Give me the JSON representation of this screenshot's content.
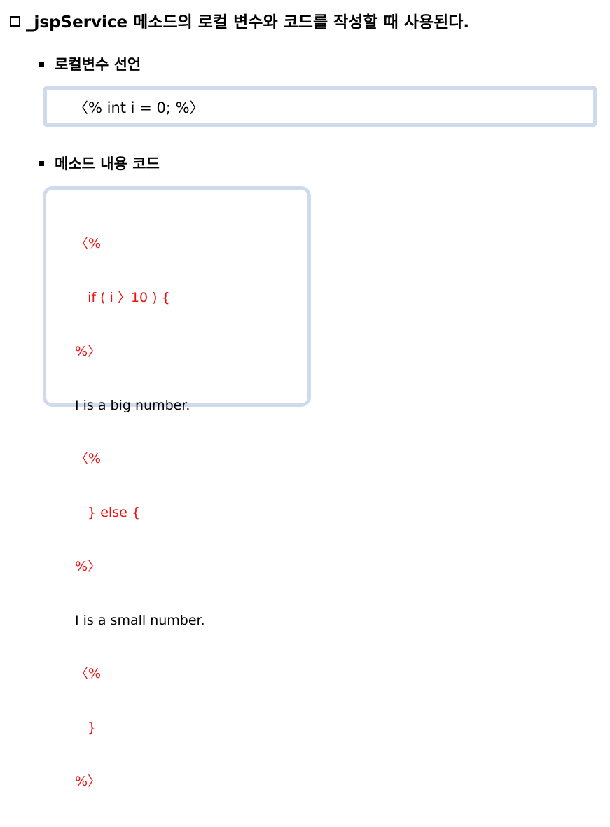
{
  "heading": {
    "text": "_jspService 메소드의 로컬 변수와 코드를 작성할 때 사용된다."
  },
  "bullets": [
    {
      "label": "로컬변수 선언"
    },
    {
      "label": "메소드 내용 코드"
    }
  ],
  "example_declaration": {
    "code": "〈% int i = 0; %〉"
  },
  "example_method": {
    "lines": [
      {
        "text": "〈%",
        "color": "#ee1111"
      },
      {
        "text": "   if ( i 〉10 ) {",
        "color": "#ee1111"
      },
      {
        "text": "%〉",
        "color": "#ee1111"
      },
      {
        "text": "I is a big number.",
        "color": "#000000"
      },
      {
        "text": "〈%",
        "color": "#ee1111"
      },
      {
        "text": "   } else {",
        "color": "#ee1111"
      },
      {
        "text": "%〉",
        "color": "#ee1111"
      },
      {
        "text": "I is a small number.",
        "color": "#000000"
      },
      {
        "text": "〈%",
        "color": "#ee1111"
      },
      {
        "text": "   }",
        "color": "#ee1111"
      },
      {
        "text": "%〉",
        "color": "#ee1111"
      }
    ]
  }
}
